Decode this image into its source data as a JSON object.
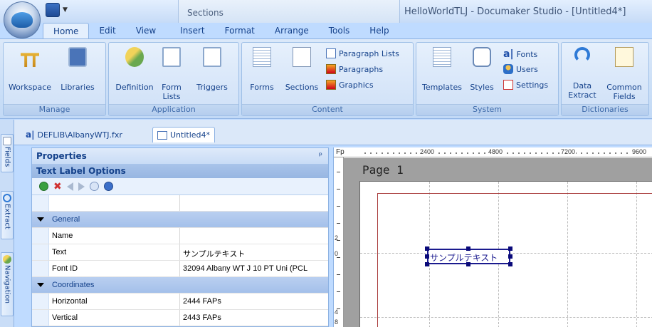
{
  "titlebar": {
    "context_tab": "Sections",
    "window_title": "HelloWorldTLJ - Documaker Studio - [Untitled4*]"
  },
  "ribbon_tabs": [
    "Home",
    "Edit",
    "View",
    "Insert",
    "Format",
    "Arrange",
    "Tools",
    "Help"
  ],
  "ribbon": {
    "manage": {
      "label": "Manage",
      "workspace": "Workspace",
      "libraries": "Libraries"
    },
    "application": {
      "label": "Application",
      "definition": "Definition",
      "form_lists_1": "Form",
      "form_lists_2": "Lists",
      "triggers": "Triggers"
    },
    "content": {
      "label": "Content",
      "forms": "Forms",
      "sections": "Sections",
      "paragraph_lists": "Paragraph Lists",
      "paragraphs": "Paragraphs",
      "graphics": "Graphics"
    },
    "system": {
      "label": "System",
      "templates": "Templates",
      "styles": "Styles",
      "fonts": "Fonts",
      "users": "Users",
      "settings": "Settings"
    },
    "dictionaries": {
      "label": "Dictionaries",
      "data_extract_1": "Data",
      "data_extract_2": "Extract",
      "common_fields_1": "Common",
      "common_fields_2": "Fields"
    }
  },
  "side_tabs": {
    "fields": "Fields",
    "extract": "Extract",
    "navigation": "Navigation"
  },
  "doc_tabs": {
    "tab1": "DEFLIB\\AlbanyWTJ.fxr",
    "tab2": "Untitled4*"
  },
  "properties": {
    "title": "Properties",
    "subtitle": "Text Label Options",
    "pin": "ᵖ",
    "rows": [
      {
        "type": "blank",
        "key": "",
        "value": ""
      },
      {
        "type": "cat",
        "key": "General",
        "value": ""
      },
      {
        "type": "prop",
        "key": "Name",
        "value": ""
      },
      {
        "type": "prop",
        "key": "Text",
        "value": "サンプルテキスト"
      },
      {
        "type": "prop",
        "key": "Font ID",
        "value": "32094 Albany WT J 10 PT Uni (PCL"
      },
      {
        "type": "cat",
        "key": "Coordinates",
        "value": ""
      },
      {
        "type": "prop",
        "key": "Horizontal",
        "value": "2444 FAPs"
      },
      {
        "type": "prop",
        "key": "Vertical",
        "value": "2443 FAPs"
      }
    ]
  },
  "canvas": {
    "ruler_corner": "Fp",
    "ruler_labels": [
      "2400",
      "4800",
      "7200",
      "9600"
    ],
    "ruler_left_labels": [
      "2",
      "0",
      "4",
      "8"
    ],
    "page_title": "Page 1",
    "text_label": "サンプルテキスト"
  }
}
